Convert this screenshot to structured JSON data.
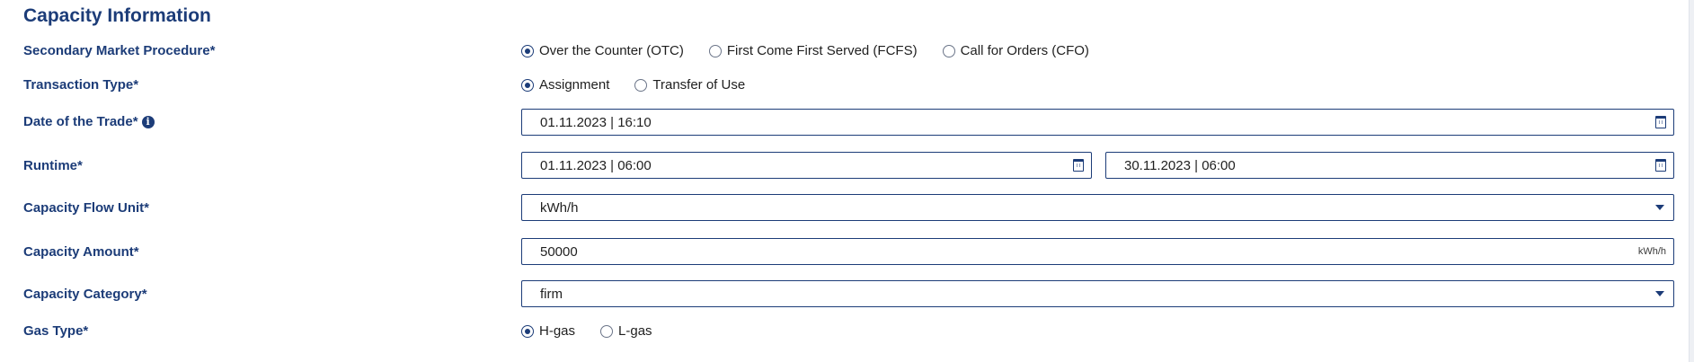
{
  "section": {
    "title": "Capacity Information"
  },
  "secondary_market_procedure": {
    "label": "Secondary Market Procedure*",
    "options": [
      {
        "label": "Over the Counter (OTC)",
        "selected": true
      },
      {
        "label": "First Come First Served (FCFS)",
        "selected": false
      },
      {
        "label": "Call for Orders (CFO)",
        "selected": false
      }
    ]
  },
  "transaction_type": {
    "label": "Transaction Type*",
    "options": [
      {
        "label": "Assignment",
        "selected": true
      },
      {
        "label": "Transfer of Use",
        "selected": false
      }
    ]
  },
  "date_of_trade": {
    "label": "Date of the Trade*",
    "info_icon": "i",
    "value": "01.11.2023 | 16:10",
    "icon": "calendar-icon"
  },
  "runtime": {
    "label": "Runtime*",
    "start_value": "01.11.2023 | 06:00",
    "end_value": "30.11.2023 | 06:00",
    "icon": "calendar-icon"
  },
  "capacity_flow_unit": {
    "label": "Capacity Flow Unit*",
    "value": "kWh/h",
    "icon": "chevron-down-icon"
  },
  "capacity_amount": {
    "label": "Capacity Amount*",
    "value": "50000",
    "unit": "kWh/h"
  },
  "capacity_category": {
    "label": "Capacity Category*",
    "value": "firm",
    "icon": "chevron-down-icon"
  },
  "gas_type": {
    "label": "Gas Type*",
    "options": [
      {
        "label": "H-gas",
        "selected": true
      },
      {
        "label": "L-gas",
        "selected": false
      }
    ]
  },
  "colors": {
    "accent": "#1c3c78",
    "border": "#1c3c78"
  }
}
